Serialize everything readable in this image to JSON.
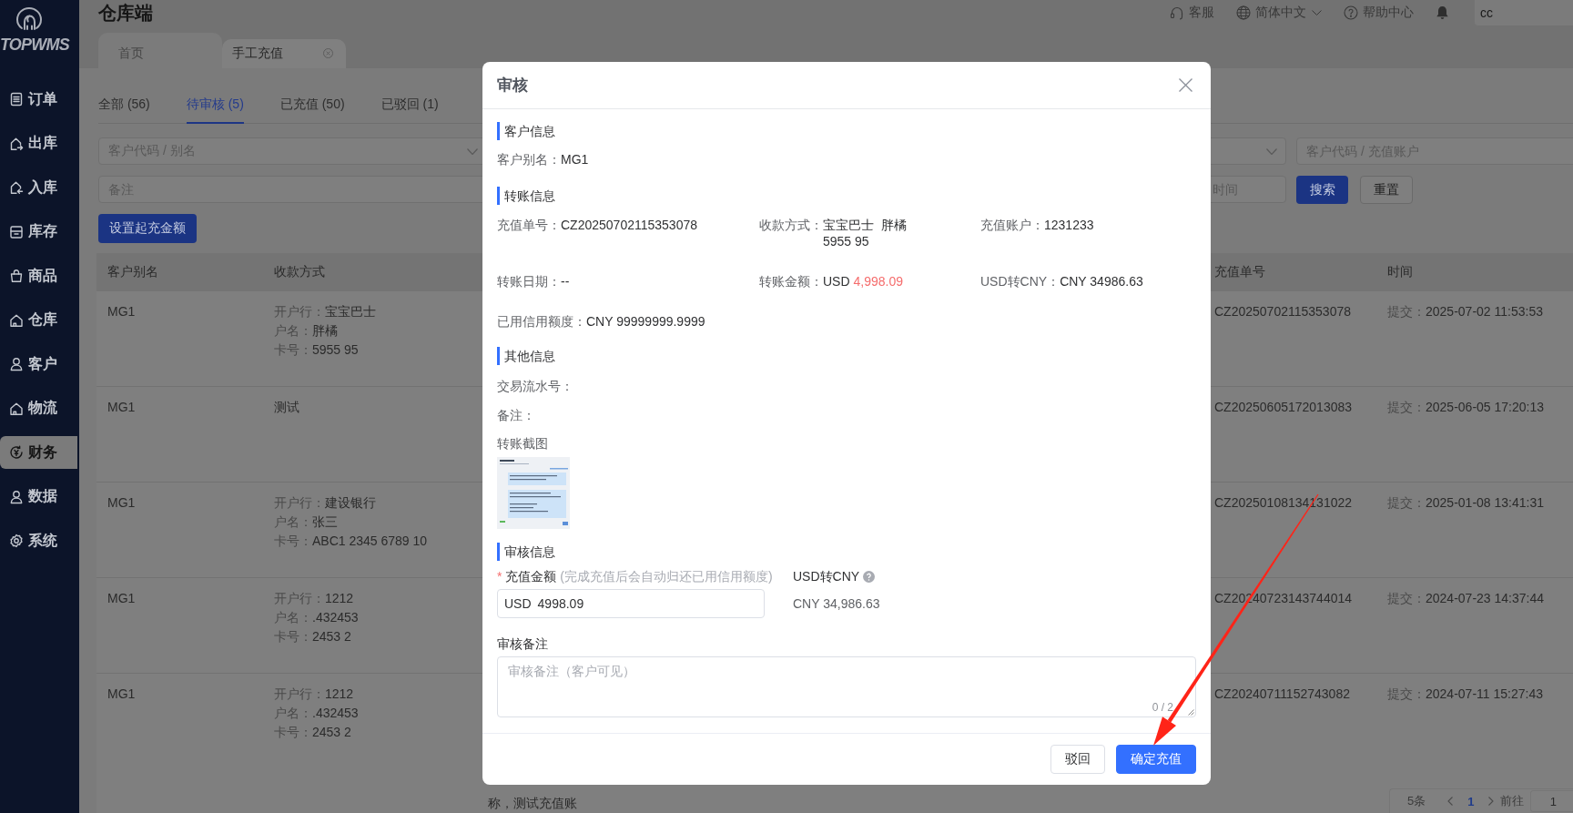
{
  "sidebar": {
    "logo": "TOPWMS",
    "items": [
      {
        "label": "订单",
        "selected": false
      },
      {
        "label": "出库",
        "selected": false
      },
      {
        "label": "入库",
        "selected": false
      },
      {
        "label": "库存",
        "selected": false
      },
      {
        "label": "商品",
        "selected": false
      },
      {
        "label": "仓库",
        "selected": false
      },
      {
        "label": "客户",
        "selected": false
      },
      {
        "label": "物流",
        "selected": false
      },
      {
        "label": "财务",
        "selected": true
      },
      {
        "label": "数据",
        "selected": false
      },
      {
        "label": "系统",
        "selected": false
      }
    ]
  },
  "header": {
    "title": "仓库端",
    "links": [
      {
        "label": "客服",
        "dropdown": false
      },
      {
        "label": "简体中文",
        "dropdown": true
      },
      {
        "label": "帮助中心",
        "dropdown": false
      }
    ],
    "user": "cc"
  },
  "page_tabs": [
    {
      "label": "首页",
      "selected": false,
      "closable": false
    },
    {
      "label": "手工充值",
      "selected": true,
      "closable": true
    }
  ],
  "status_tabs": [
    {
      "label": "全部 (56)",
      "selected": false
    },
    {
      "label": "待审核 (5)",
      "selected": true
    },
    {
      "label": "已充值 (50)",
      "selected": false
    },
    {
      "label": "已驳回 (1)",
      "selected": false
    }
  ],
  "filters": {
    "customer": {
      "placeholder": "客户代码 / 别名"
    },
    "account": {
      "placeholder": "客户代码 / 充值账户"
    },
    "remark": {
      "placeholder": "备注"
    },
    "time": {
      "placeholder": "时间"
    },
    "search_button": "搜索",
    "reset_button": "重置"
  },
  "set_min_amount_button": "设置起充金额",
  "table": {
    "columns": [
      {
        "label": "客户别名"
      },
      {
        "label": "收款方式"
      },
      {
        "label": "充值单号"
      },
      {
        "label": "时间"
      }
    ],
    "rows": [
      {
        "alias": "MG1",
        "payment": [
          {
            "label": "开户行：",
            "value": "宝宝巴士"
          },
          {
            "label": "户名：",
            "value": "胖橘"
          },
          {
            "label": "卡号：",
            "value": "5955 95"
          }
        ],
        "order_no": "CZ20250702115353078",
        "time_label": "提交：",
        "time": "2025-07-02 11:53:53"
      },
      {
        "alias": "MG1",
        "payment": [
          {
            "value": "测试"
          }
        ],
        "order_no": "CZ20250605172013083",
        "time_label": "提交：",
        "time": "2025-06-05 17:20:13"
      },
      {
        "alias": "MG1",
        "payment": [
          {
            "label": "开户行：",
            "value": "建设银行"
          },
          {
            "label": "户名：",
            "value": "张三"
          },
          {
            "label": "卡号：",
            "value": "ABC1 2345 6789 10"
          }
        ],
        "order_no": "CZ20250108134131022",
        "time_label": "提交：",
        "time": "2025-01-08 13:41:31"
      },
      {
        "alias": "MG1",
        "payment": [
          {
            "label": "开户行：",
            "value": "1212"
          },
          {
            "label": "户名：",
            "value": ".432453"
          },
          {
            "label": "卡号：",
            "value": "2453 2"
          }
        ],
        "order_no": "CZ20240723143744014",
        "time_label": "提交：",
        "time": "2024-07-23 14:37:44"
      },
      {
        "alias": "MG1",
        "payment": [
          {
            "label": "开户行：",
            "value": "1212"
          },
          {
            "label": "户名：",
            "value": ".432453"
          },
          {
            "label": "卡号：",
            "value": "2453 2"
          }
        ],
        "column_3": "称，测试充值账",
        "order_no": "CZ20240711152743082",
        "time_label": "提交：",
        "time": "2024-07-11 15:27:43"
      }
    ]
  },
  "pagination": {
    "total": "5条",
    "pages": [
      {
        "label": "1",
        "selected": true
      }
    ],
    "goto_label": "前往",
    "goto_value": "1"
  },
  "dialog": {
    "title": "审核",
    "customer_section": {
      "title": "客户信息",
      "fields": [
        {
          "label": "客户别名：",
          "value": "MG1"
        }
      ]
    },
    "transfer_section": {
      "title": "转账信息",
      "fields": [
        {
          "kind": "text",
          "label": "充值单号：",
          "value": "CZ20250702115353078"
        },
        {
          "kind": "lines",
          "label": "收款方式：",
          "lines": [
            "宝宝巴士  胖橘",
            "5955 95"
          ]
        },
        {
          "kind": "text",
          "label": "充值账户：",
          "value": "1231233"
        },
        {
          "kind": "text",
          "label": "转账日期：",
          "value": "--"
        },
        {
          "kind": "amount",
          "label": "转账金额：",
          "currency": "USD",
          "amount": "4,998.09"
        },
        {
          "kind": "text",
          "label": "USD转CNY：",
          "value": "CNY 34986.63"
        },
        {
          "kind": "text",
          "label": "已用信用额度：",
          "value": "CNY 99999999.9999"
        }
      ]
    },
    "other_section": {
      "title": "其他信息",
      "fields": [
        {
          "label": "交易流水号："
        },
        {
          "label": "备注："
        }
      ],
      "screenshot_label": "转账截图"
    },
    "review_section": {
      "title": "审核信息",
      "required_mark": "*",
      "amount_label": "充值金额",
      "amount_hint": "(完成充值后会自动归还已用信用额度)",
      "currency": "USD",
      "amount_value": "4998.09",
      "rate_label": "USD转CNY",
      "rate_value": "CNY 34,986.63",
      "remark_label": "审核备注",
      "remark_placeholder": "审核备注（客户可见）",
      "remark_counter": "0 / 2"
    },
    "buttons": [
      {
        "label": "驳回",
        "kind": "default"
      },
      {
        "label": "确定充值",
        "kind": "primary"
      }
    ]
  }
}
